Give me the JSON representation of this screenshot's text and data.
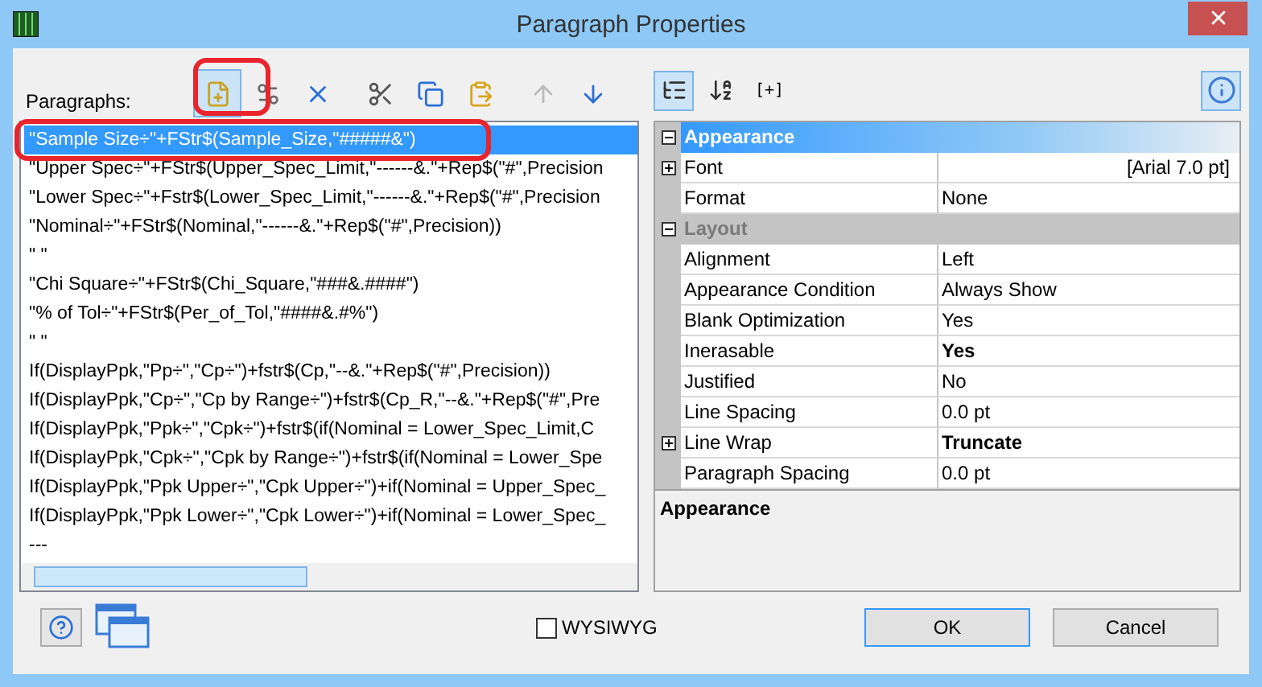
{
  "window": {
    "title": "Paragraph Properties"
  },
  "paragraphs": {
    "label": "Paragraphs:",
    "toolbar": [
      {
        "hovered": true,
        "disabled": false
      },
      {
        "hovered": false,
        "disabled": false
      },
      {
        "hovered": false,
        "disabled": false
      },
      {
        "hovered": false,
        "disabled": false
      },
      {
        "hovered": false,
        "disabled": false
      },
      {
        "hovered": false,
        "disabled": false
      },
      {
        "hovered": false,
        "disabled": true
      },
      {
        "hovered": false,
        "disabled": false
      }
    ],
    "items": [
      {
        "text": "\"Sample Size÷\"+FStr$(Sample_Size,\"#####&\")",
        "selected": true
      },
      {
        "text": "\"Upper Spec÷\"+FStr$(Upper_Spec_Limit,\"------&.\"+Rep$(\"#\",Precision",
        "selected": false
      },
      {
        "text": "\"Lower Spec÷\"+Fstr$(Lower_Spec_Limit,\"------&.\"+Rep$(\"#\",Precision",
        "selected": false
      },
      {
        "text": "\"Nominal÷\"+FStr$(Nominal,\"------&.\"+Rep$(\"#\",Precision))",
        "selected": false
      },
      {
        "text": "\" \"",
        "selected": false
      },
      {
        "text": "\"Chi Square÷\"+FStr$(Chi_Square,\"###&.####\")",
        "selected": false
      },
      {
        "text": "\"% of Tol÷\"+FStr$(Per_of_Tol,\"####&.#%\")",
        "selected": false
      },
      {
        "text": "\" \"",
        "selected": false
      },
      {
        "text": "If(DisplayPpk,\"Pp÷\",\"Cp÷\")+fstr$(Cp,\"--&.\"+Rep$(\"#\",Precision))",
        "selected": false
      },
      {
        "text": "If(DisplayPpk,\"Cp÷\",\"Cp by Range÷\")+fstr$(Cp_R,\"--&.\"+Rep$(\"#\",Pre",
        "selected": false
      },
      {
        "text": "If(DisplayPpk,\"Ppk÷\",\"Cpk÷\")+fstr$(if(Nominal = Lower_Spec_Limit,C",
        "selected": false
      },
      {
        "text": "If(DisplayPpk,\"Cpk÷\",\"Cpk by Range÷\")+fstr$(if(Nominal = Lower_Spe",
        "selected": false
      },
      {
        "text": "If(DisplayPpk,\"Ppk Upper÷\",\"Cpk Upper÷\")+if(Nominal = Upper_Spec_",
        "selected": false
      },
      {
        "text": "If(DisplayPpk,\"Ppk Lower÷\",\"Cpk Lower÷\")+if(Nominal = Lower_Spec_",
        "selected": false
      },
      {
        "text": "---",
        "selected": false
      }
    ]
  },
  "properties": {
    "toolbar": [
      {
        "kind": "icon",
        "selected": true
      },
      {
        "kind": "icon",
        "selected": false
      },
      {
        "kind": "text",
        "text": "[+]",
        "selected": false
      }
    ],
    "info_selected": true,
    "rows": [
      {
        "kind": "category",
        "name": "Appearance",
        "expanded": true,
        "selected": true
      },
      {
        "kind": "property",
        "name": "Font",
        "value": "[Arial 7.0 pt]",
        "right_aligned": true,
        "expandable": true,
        "bold": false
      },
      {
        "kind": "property",
        "name": "Format",
        "value": "None",
        "right_aligned": false,
        "expandable": false,
        "bold": false
      },
      {
        "kind": "category",
        "name": "Layout",
        "expanded": true,
        "selected": false
      },
      {
        "kind": "property",
        "name": "Alignment",
        "value": "Left",
        "right_aligned": false,
        "expandable": false,
        "bold": false
      },
      {
        "kind": "property",
        "name": "Appearance Condition",
        "value": "Always Show",
        "right_aligned": false,
        "expandable": false,
        "bold": false
      },
      {
        "kind": "property",
        "name": "Blank Optimization",
        "value": "Yes",
        "right_aligned": false,
        "expandable": false,
        "bold": false
      },
      {
        "kind": "property",
        "name": "Inerasable",
        "value": "Yes",
        "right_aligned": false,
        "expandable": false,
        "bold": true
      },
      {
        "kind": "property",
        "name": "Justified",
        "value": "No",
        "right_aligned": false,
        "expandable": false,
        "bold": false
      },
      {
        "kind": "property",
        "name": "Line Spacing",
        "value": "0.0 pt",
        "right_aligned": false,
        "expandable": false,
        "bold": false
      },
      {
        "kind": "property",
        "name": "Line Wrap",
        "value": "Truncate",
        "right_aligned": false,
        "expandable": true,
        "bold": true
      },
      {
        "kind": "property",
        "name": "Paragraph Spacing",
        "value": "0.0 pt",
        "right_aligned": false,
        "expandable": false,
        "bold": false
      }
    ],
    "description": "Appearance"
  },
  "wysiwyg": {
    "label": "WYSIWYG",
    "checked": false
  },
  "buttons": [
    "OK",
    "Cancel"
  ]
}
